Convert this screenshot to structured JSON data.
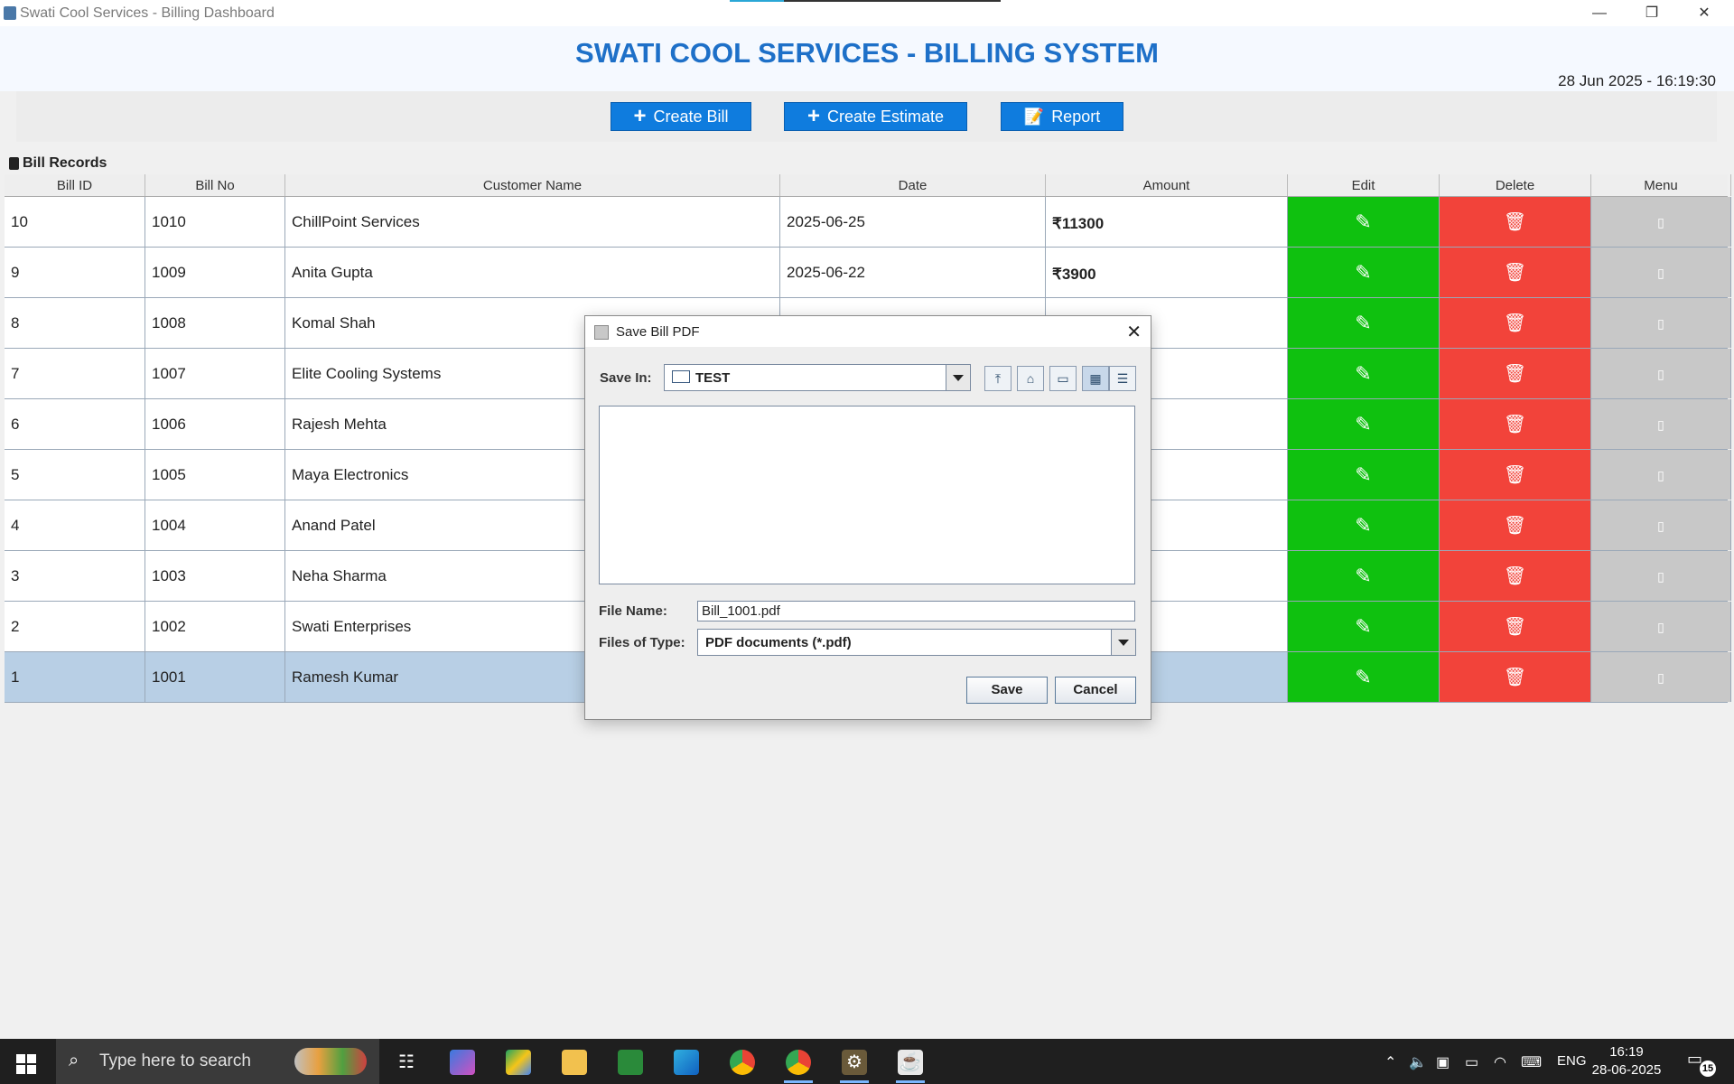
{
  "window": {
    "title": "Swati Cool Services - Billing Dashboard",
    "min": "—",
    "max": "❐",
    "close": "✕"
  },
  "header": {
    "title": "SWATI COOL SERVICES - BILLING SYSTEM",
    "datetime": "28 Jun 2025 - 16:19:30"
  },
  "toolbar": {
    "create_bill": "Create Bill",
    "create_estimate": "Create Estimate",
    "report": "Report",
    "plus_icon": "+",
    "report_icon": "📝"
  },
  "records": {
    "label": "Bill Records",
    "columns": [
      "Bill ID",
      "Bill No",
      "Customer Name",
      "Date",
      "Amount",
      "Edit",
      "Delete",
      "Menu"
    ],
    "edit_icon": "✎",
    "delete_icon": "🗑",
    "menu_icon": "▯",
    "rows": [
      {
        "id": "10",
        "no": "1010",
        "name": "ChillPoint Services",
        "date": "2025-06-25",
        "amount": "₹11300"
      },
      {
        "id": "9",
        "no": "1009",
        "name": "Anita Gupta",
        "date": "2025-06-22",
        "amount": "₹3900"
      },
      {
        "id": "8",
        "no": "1008",
        "name": "Komal Shah",
        "date": "",
        "amount": ""
      },
      {
        "id": "7",
        "no": "1007",
        "name": "Elite Cooling Systems",
        "date": "",
        "amount": ""
      },
      {
        "id": "6",
        "no": "1006",
        "name": "Rajesh Mehta",
        "date": "",
        "amount": ""
      },
      {
        "id": "5",
        "no": "1005",
        "name": "Maya Electronics",
        "date": "",
        "amount": ""
      },
      {
        "id": "4",
        "no": "1004",
        "name": "Anand Patel",
        "date": "",
        "amount": ""
      },
      {
        "id": "3",
        "no": "1003",
        "name": "Neha Sharma",
        "date": "",
        "amount": ""
      },
      {
        "id": "2",
        "no": "1002",
        "name": "Swati Enterprises",
        "date": "",
        "amount": ""
      },
      {
        "id": "1",
        "no": "1001",
        "name": "Ramesh Kumar",
        "date": "",
        "amount": ""
      }
    ]
  },
  "dialog": {
    "title": "Save Bill PDF",
    "close": "✕",
    "save_in_label": "Save In:",
    "save_in_value": "TEST",
    "file_name_label": "File Name:",
    "file_name_value": "Bill_1001.pdf",
    "files_of_type_label": "Files of Type:",
    "files_of_type_value": "PDF documents (*.pdf)",
    "save": "Save",
    "cancel": "Cancel",
    "nav_icons": {
      "up": "⤒",
      "home": "⌂",
      "new_folder": "▭",
      "list": "▦",
      "details": "☰"
    }
  },
  "taskbar": {
    "search_placeholder": "Type here to search",
    "tray_lang": "ENG",
    "time": "16:19",
    "date": "28-06-2025",
    "notifications": "15",
    "accent": "#7ab7ff"
  }
}
